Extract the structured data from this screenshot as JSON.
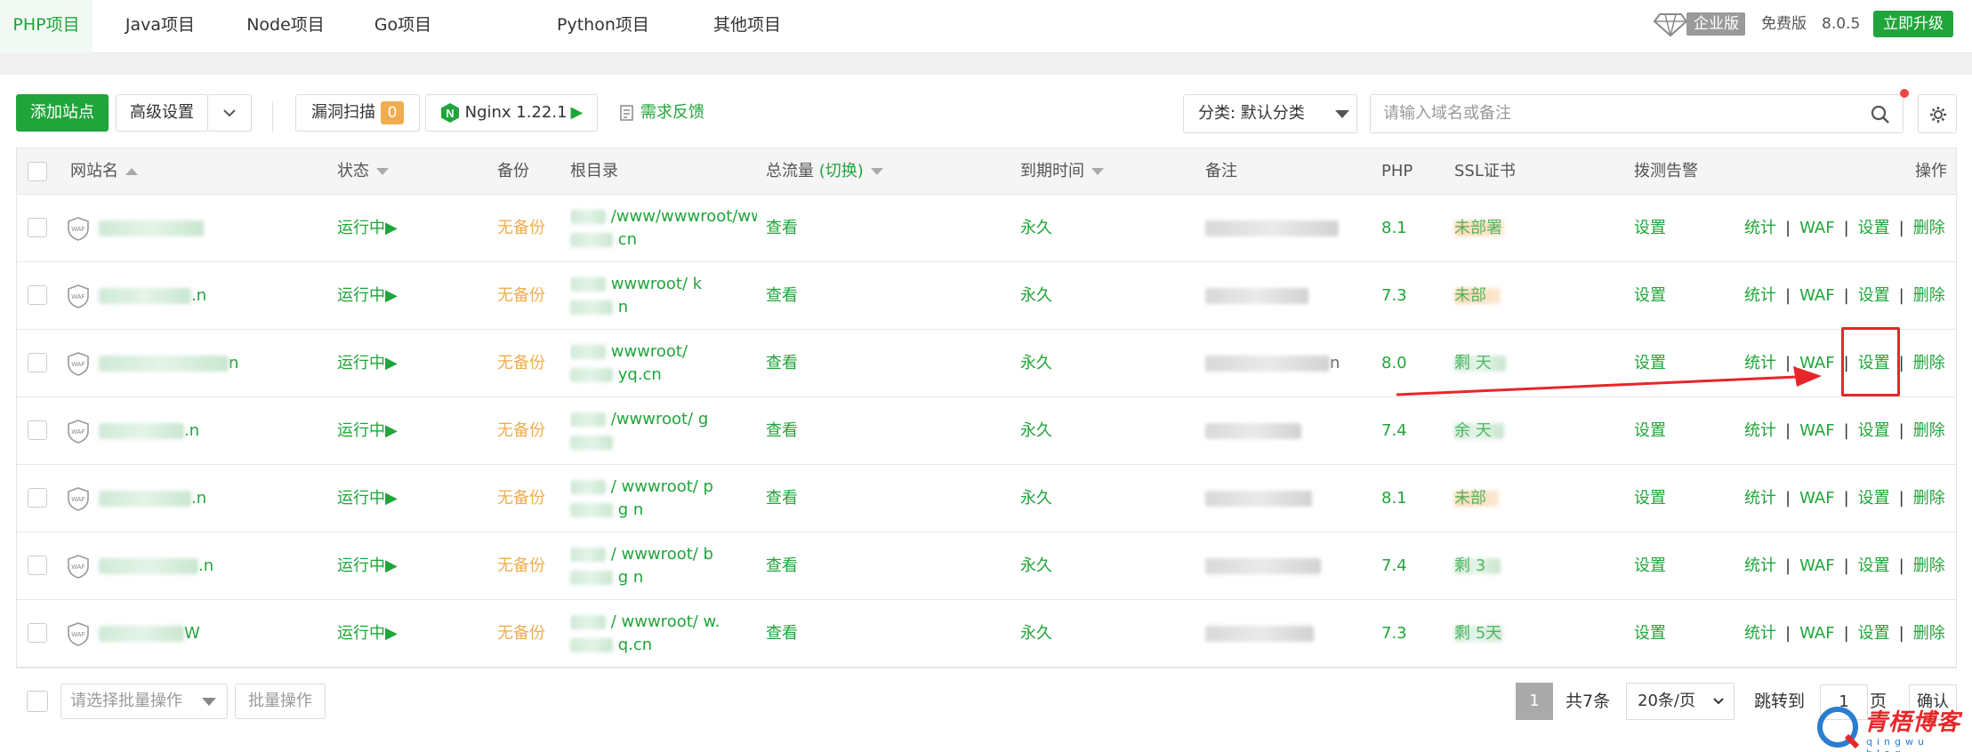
{
  "tabs": [
    {
      "label": "PHP项目",
      "active": true
    },
    {
      "label": "Java项目"
    },
    {
      "label": "Node项目"
    },
    {
      "label": "Go项目"
    },
    {
      "label": "Python项目"
    },
    {
      "label": "其他项目"
    }
  ],
  "version_info": {
    "enterprise_label": "企业版",
    "free_label": "免费版",
    "version": "8.0.5",
    "upgrade_label": "立即升级"
  },
  "toolbar": {
    "add_site_label": "添加站点",
    "advanced_label": "高级设置",
    "vuln_scan_label": "漏洞扫描",
    "vuln_count": "0",
    "nginx_label": "Nginx 1.22.1",
    "feedback_label": "需求反馈",
    "category_label": "分类: 默认分类",
    "search_placeholder": "请输入域名或备注"
  },
  "table": {
    "headers": {
      "site_name": "网站名",
      "status": "状态",
      "backup": "备份",
      "root": "根目录",
      "traffic": "总流量",
      "traffic_switch": "(切换)",
      "expire": "到期时间",
      "remark": "备注",
      "php": "PHP",
      "ssl": "SSL证书",
      "probe": "拨测告警",
      "ops": "操作"
    },
    "rows": [
      {
        "name_tail": "",
        "status": "运行中▶",
        "backup": "无备份",
        "root_l1": "/www/wwwroot/www.",
        "root_l2": "cn",
        "traffic": "查看",
        "expire": "永久",
        "remark_tail": "",
        "php": "8.1",
        "ssl": "未部署",
        "probe": "设置"
      },
      {
        "name_tail": ".n",
        "status": "运行中▶",
        "backup": "无备份",
        "root_l1": "wwwroot/ k",
        "root_l2": "n",
        "traffic": "查看",
        "expire": "永久",
        "remark_tail": "",
        "php": "7.3",
        "ssl": "未部署",
        "probe": "设置"
      },
      {
        "name_tail": "n",
        "status": "运行中▶",
        "backup": "无备份",
        "root_l1": "wwwroot/",
        "root_l2": "yq.cn",
        "traffic": "查看",
        "expire": "永久",
        "remark_tail": "n",
        "php": "8.0",
        "ssl": "剩 天",
        "probe": "设置"
      },
      {
        "name_tail": ".n",
        "status": "运行中▶",
        "backup": "无备份",
        "root_l1": "/wwwroot/ g",
        "root_l2": "",
        "traffic": "查看",
        "expire": "永久",
        "remark_tail": "",
        "php": "7.4",
        "ssl": "余 天",
        "probe": "设置"
      },
      {
        "name_tail": ".n",
        "status": "运行中▶",
        "backup": "无备份",
        "root_l1": "/ wwwroot/ p",
        "root_l2": "g n",
        "traffic": "查看",
        "expire": "永久",
        "remark_tail": "",
        "php": "8.1",
        "ssl": "未部",
        "probe": "设置"
      },
      {
        "name_tail": ".n",
        "status": "运行中▶",
        "backup": "无备份",
        "root_l1": "/ wwwroot/ b",
        "root_l2": "g n",
        "traffic": "查看",
        "expire": "永久",
        "remark_tail": "",
        "php": "7.4",
        "ssl": "剩 3天",
        "probe": "设置"
      },
      {
        "name_tail": "W",
        "status": "运行中▶",
        "backup": "无备份",
        "root_l1": "/ wwwroot/ w.",
        "root_l2": "q.cn",
        "traffic": "查看",
        "expire": "永久",
        "remark_tail": "",
        "php": "7.3",
        "ssl": "剩 5天",
        "probe": "设置"
      }
    ],
    "ops": {
      "stats": "统计",
      "waf": "WAF",
      "settings": "设置",
      "delete": "删除",
      "sep": "|"
    }
  },
  "footer": {
    "batch_placeholder": "请选择批量操作",
    "batch_btn": "批量操作",
    "current_page": "1",
    "total": "共7条",
    "page_size": "20条/页",
    "jump_label": "跳转到",
    "jump_value": "1",
    "page_unit": "页",
    "confirm": "确认"
  },
  "watermark": {
    "text": "青梧博客",
    "sub": "qingwu blog"
  },
  "colors": {
    "accent": "#20a53a",
    "warning": "#f0ad4e",
    "annotation": "#e8262a"
  }
}
